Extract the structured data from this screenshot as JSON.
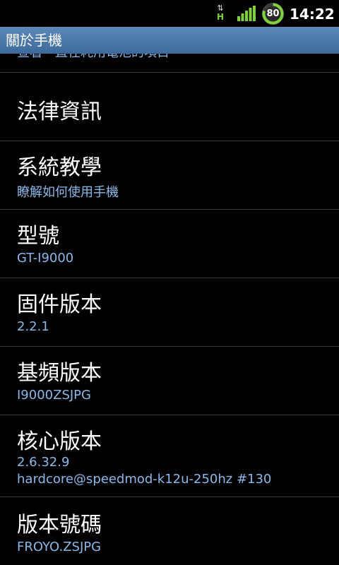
{
  "status_bar": {
    "network_type": "H",
    "battery_level": "80",
    "time": "14:22",
    "accent_color": "#7fd13a"
  },
  "title_bar": {
    "title": "關於手機"
  },
  "list": {
    "partial_item": {
      "summary": "查看一直在耗用電池的項目"
    },
    "items": [
      {
        "title": "法律資訊",
        "summary": ""
      },
      {
        "title": "系統教學",
        "summary": "瞭解如何使用手機"
      },
      {
        "title": "型號",
        "summary": "GT-I9000"
      },
      {
        "title": "固件版本",
        "summary": "2.2.1"
      },
      {
        "title": "基頻版本",
        "summary": "I9000ZSJPG"
      },
      {
        "title": "核心版本",
        "summary": "2.6.32.9",
        "summary2": "hardcore@speedmod-k12u-250hz #130"
      },
      {
        "title": "版本號碼",
        "summary": "FROYO.ZSJPG"
      }
    ]
  }
}
